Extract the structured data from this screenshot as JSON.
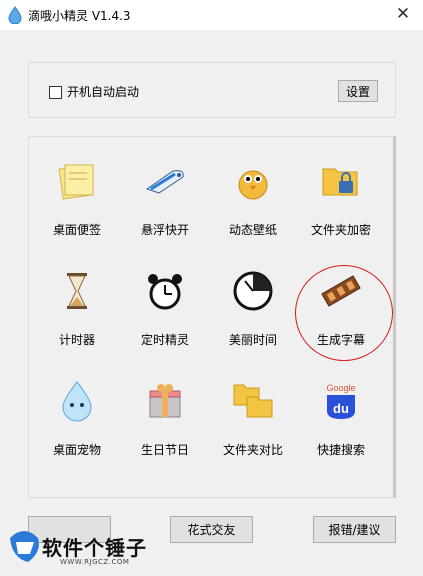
{
  "window": {
    "title": "滴哦小精灵 V1.4.3",
    "close_label": "✕"
  },
  "settings": {
    "autostart_label": "开机自动启动",
    "autostart_checked": false,
    "settings_button": "设置"
  },
  "tools": [
    {
      "label": "桌面便签",
      "icon": "sticky-note-icon"
    },
    {
      "label": "悬浮快开",
      "icon": "bullet-train-icon"
    },
    {
      "label": "动态壁纸",
      "icon": "chick-icon"
    },
    {
      "label": "文件夹加密",
      "icon": "folder-lock-icon"
    },
    {
      "label": "计时器",
      "icon": "hourglass-icon"
    },
    {
      "label": "定时精灵",
      "icon": "alarm-clock-icon"
    },
    {
      "label": "美丽时间",
      "icon": "clock-face-icon"
    },
    {
      "label": "生成字幕",
      "icon": "film-strip-icon"
    },
    {
      "label": "桌面宠物",
      "icon": "droplet-pet-icon"
    },
    {
      "label": "生日节日",
      "icon": "gift-box-icon"
    },
    {
      "label": "文件夹对比",
      "icon": "folder-compare-icon"
    },
    {
      "label": "快捷搜索",
      "icon": "baidu-search-icon"
    }
  ],
  "bottom_buttons": {
    "left": "",
    "middle": "花式交友",
    "right": "报错/建议"
  },
  "watermark": {
    "text": "软件个锤子",
    "url": "WWW.RJGCZ.COM"
  },
  "colors": {
    "highlight_ring": "#d61a1a",
    "accent_blue": "#2a7bd8"
  }
}
